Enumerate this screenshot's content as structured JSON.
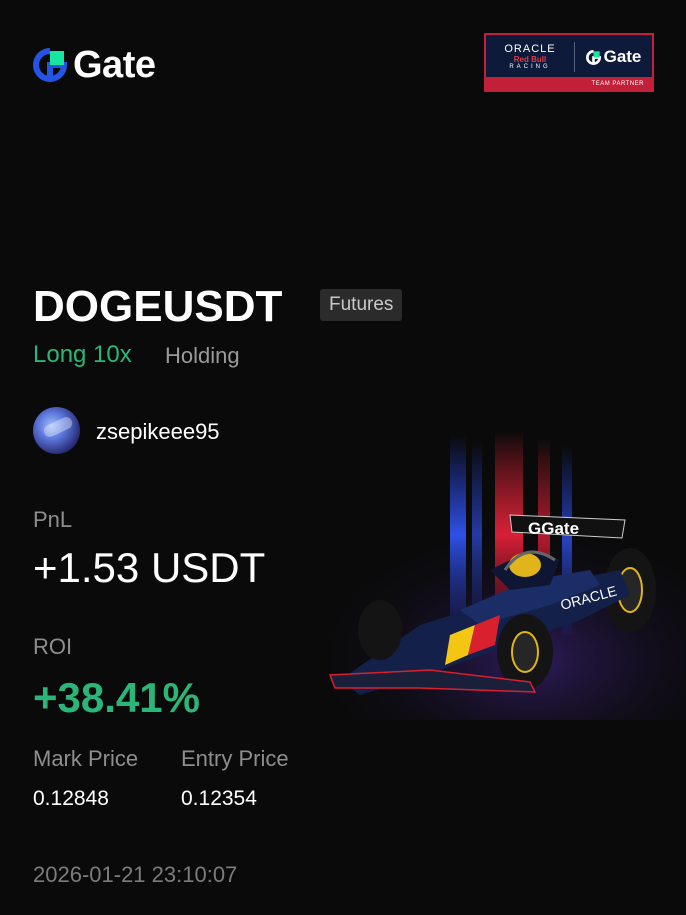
{
  "brand": {
    "name": "Gate",
    "accent": "#2354E6",
    "accent_green": "#17E6A1"
  },
  "partner": {
    "oracle": "ORACLE",
    "redbull": "Red Bull",
    "racing": "RACING",
    "gate": "Gate",
    "badge": "TEAM PARTNER"
  },
  "position": {
    "symbol": "DOGEUSDT",
    "market": "Futures",
    "direction": "Long 10x",
    "status": "Holding"
  },
  "user": {
    "username": "zsepikeee95"
  },
  "stats": {
    "pnl_label": "PnL",
    "pnl_value": "+1.53 USDT",
    "roi_label": "ROI",
    "roi_value": "+38.41%",
    "mark_label": "Mark Price",
    "mark_value": "0.12848",
    "entry_label": "Entry Price",
    "entry_value": "0.12354"
  },
  "timestamp": "2026-01-21 23:10:07",
  "colors": {
    "positive": "#2BB679",
    "background": "#0A0A0A"
  },
  "art": {
    "car_text": "Gate",
    "sponsor_text": "ORACLE"
  }
}
